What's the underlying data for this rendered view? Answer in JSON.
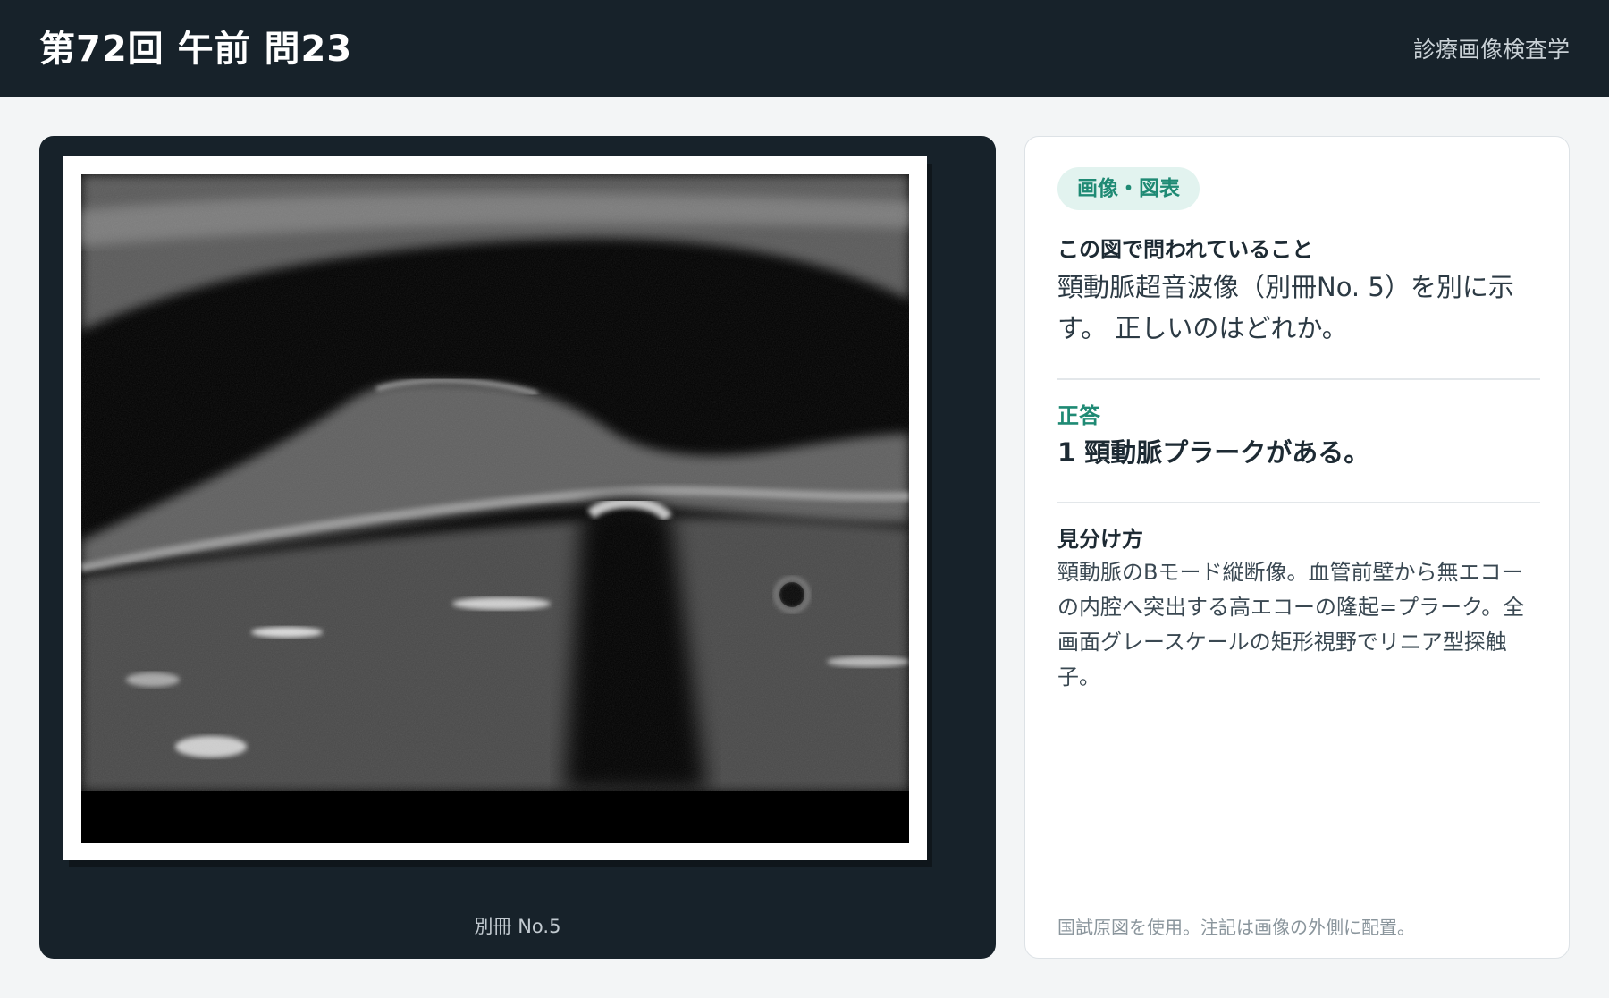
{
  "header": {
    "title": "第72回 午前 問23",
    "category": "診療画像検査学"
  },
  "figure": {
    "caption": "別冊 No.5",
    "image_description": "carotid-ultrasound-b-mode"
  },
  "panel": {
    "badge": "画像・図表",
    "question_heading": "この図で問われていること",
    "question_text": "頸動脈超音波像（別冊No. 5）を別に示す。 正しいのはどれか。",
    "answer_label": "正答",
    "answer_text": "1 頸動脈プラークがある。",
    "tips_heading": "見分け方",
    "tips_text": "頸動脈のBモード縦断像。血管前壁から無エコーの内腔へ突出する高エコーの隆起=プラーク。全画面グレースケールの矩形視野でリニア型探触子。",
    "footnote": "国試原図を使用。注記は画像の外側に配置。"
  },
  "colors": {
    "header_bg": "#17222a",
    "accent": "#1f8a74",
    "badge_bg": "#e2f3ef"
  }
}
